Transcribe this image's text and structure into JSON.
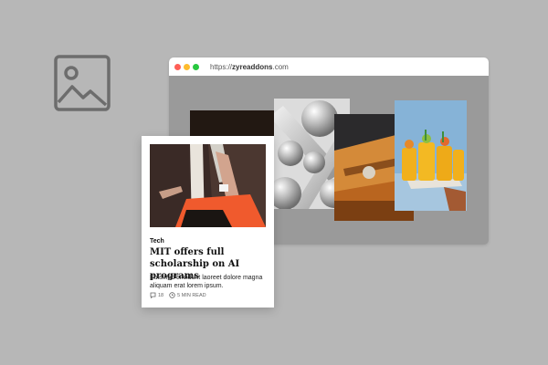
{
  "browser": {
    "url_prefix": "https://",
    "url_domain": "zyreaddons",
    "url_suffix": ".com",
    "dots": [
      "#ff5f57",
      "#febc2e",
      "#28c840"
    ]
  },
  "icons": {
    "placeholder": "image-placeholder-icon",
    "comment": "comment-icon",
    "clock": "clock-icon"
  },
  "card": {
    "category": "Tech",
    "title": "MIT offers full scholarship on AI programs",
    "excerpt": "Euismod tincidunt laoreet dolore magna aliquam erat lorem ipsum.",
    "comments": "18",
    "read_time": "5 MIN READ"
  }
}
